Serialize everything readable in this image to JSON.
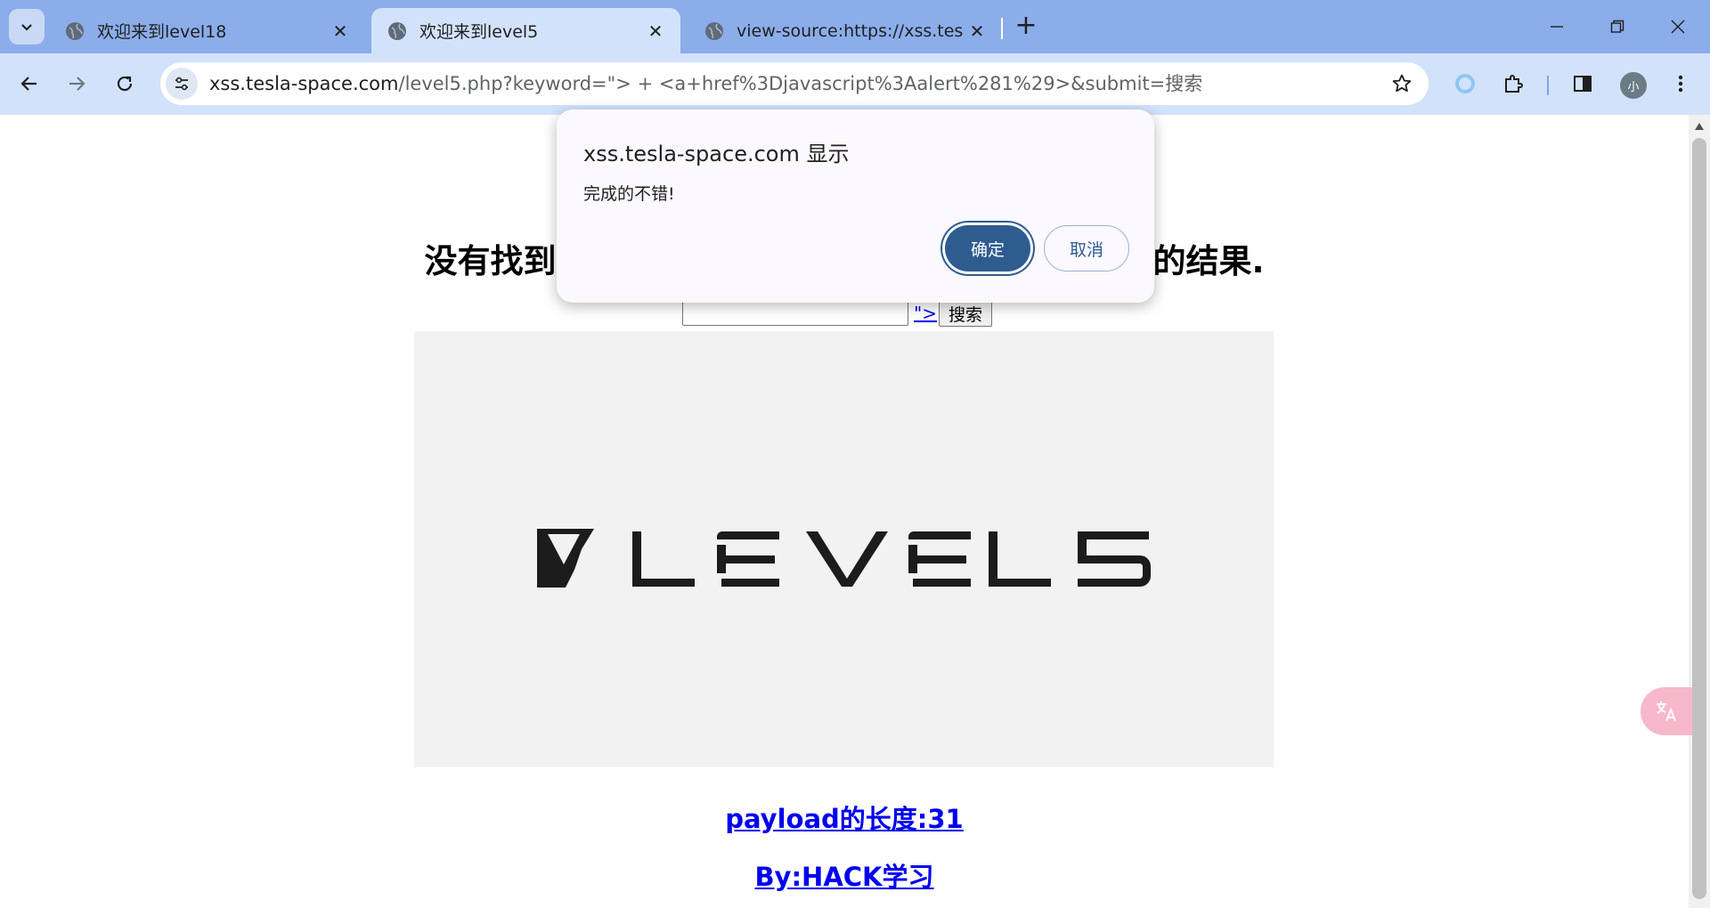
{
  "browser": {
    "tabs": [
      {
        "title": "欢迎来到level18",
        "active": false
      },
      {
        "title": "欢迎来到level5",
        "active": true
      },
      {
        "title": "view-source:https://xss.tesla-",
        "active": false
      }
    ],
    "new_tab_label": "+",
    "url_host": "xss.tesla-space.com",
    "url_rest": "/level5.php?keyword=\"> + <a+href%3Djavascript%3Aalert%281%29>&submit=搜索",
    "profile_initial": "小",
    "accent": "#8badea",
    "toolbar_color": "#d3e2fb"
  },
  "page": {
    "heading_left": "没有找到",
    "heading_right": "的结果.",
    "injected_link_text": "\">",
    "search_button": "搜索",
    "logo_text": "LEVEL5",
    "payload_length": "payload的长度:31",
    "byline": "By:HACK学习"
  },
  "dialog": {
    "title": "xss.tesla-space.com 显示",
    "message": "完成的不错!",
    "ok_label": "确定",
    "cancel_label": "取消"
  }
}
